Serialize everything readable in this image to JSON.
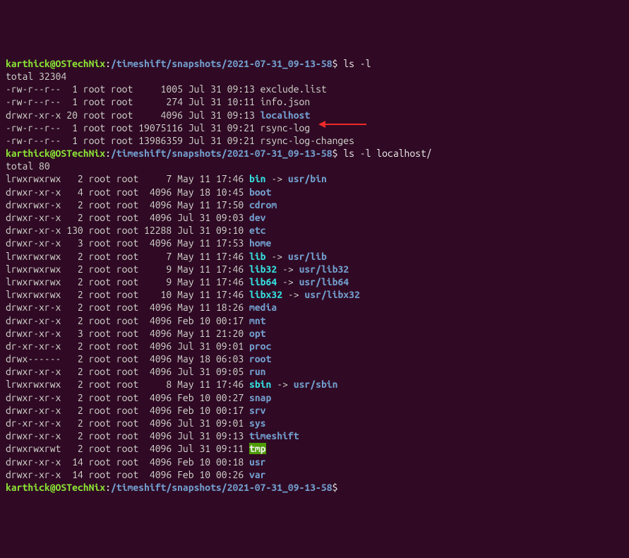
{
  "prompt1": {
    "user": "karthick@OSTechNix",
    "colon": ":",
    "path": "/timeshift/snapshots/2021-07-31_09-13-58",
    "dollar": "$",
    "cmd": " ls -l"
  },
  "total1": "total 32304",
  "listing1": [
    {
      "perm": "-rw-r--r--",
      "links": "  1",
      "owner": " root",
      "group": " root",
      "size": "     1005",
      "date": " Jul 31 09:13 ",
      "name": "exclude.list",
      "type": "file"
    },
    {
      "perm": "-rw-r--r--",
      "links": "  1",
      "owner": " root",
      "group": " root",
      "size": "      274",
      "date": " Jul 31 10:11 ",
      "name": "info.json",
      "type": "file"
    },
    {
      "perm": "drwxr-xr-x",
      "links": " 20",
      "owner": " root",
      "group": " root",
      "size": "     4096",
      "date": " Jul 31 09:13 ",
      "name": "localhost",
      "type": "dir",
      "arrow": true
    },
    {
      "perm": "-rw-r--r--",
      "links": "  1",
      "owner": " root",
      "group": " root",
      "size": " 19075116",
      "date": " Jul 31 09:21 ",
      "name": "rsync-log",
      "type": "file"
    },
    {
      "perm": "-rw-r--r--",
      "links": "  1",
      "owner": " root",
      "group": " root",
      "size": " 13986359",
      "date": " Jul 31 09:21 ",
      "name": "rsync-log-changes",
      "type": "file"
    }
  ],
  "prompt2": {
    "user": "karthick@OSTechNix",
    "colon": ":",
    "path": "/timeshift/snapshots/2021-07-31_09-13-58",
    "dollar": "$",
    "cmd": " ls -l localhost/"
  },
  "total2": "total 80",
  "listing2": [
    {
      "perm": "lrwxrwxrwx",
      "links": "   2",
      "owner": " root",
      "group": " root",
      "size": "     7",
      "date": " May 11 17:46 ",
      "name": "bin",
      "type": "link",
      "target": "usr/bin"
    },
    {
      "perm": "drwxr-xr-x",
      "links": "   4",
      "owner": " root",
      "group": " root",
      "size": "  4096",
      "date": " May 18 10:45 ",
      "name": "boot",
      "type": "dir"
    },
    {
      "perm": "drwxrwxr-x",
      "links": "   2",
      "owner": " root",
      "group": " root",
      "size": "  4096",
      "date": " May 11 17:50 ",
      "name": "cdrom",
      "type": "dir"
    },
    {
      "perm": "drwxr-xr-x",
      "links": "   2",
      "owner": " root",
      "group": " root",
      "size": "  4096",
      "date": " Jul 31 09:03 ",
      "name": "dev",
      "type": "dir"
    },
    {
      "perm": "drwxr-xr-x",
      "links": " 130",
      "owner": " root",
      "group": " root",
      "size": " 12288",
      "date": " Jul 31 09:10 ",
      "name": "etc",
      "type": "dir"
    },
    {
      "perm": "drwxr-xr-x",
      "links": "   3",
      "owner": " root",
      "group": " root",
      "size": "  4096",
      "date": " May 11 17:53 ",
      "name": "home",
      "type": "dir"
    },
    {
      "perm": "lrwxrwxrwx",
      "links": "   2",
      "owner": " root",
      "group": " root",
      "size": "     7",
      "date": " May 11 17:46 ",
      "name": "lib",
      "type": "link",
      "target": "usr/lib"
    },
    {
      "perm": "lrwxrwxrwx",
      "links": "   2",
      "owner": " root",
      "group": " root",
      "size": "     9",
      "date": " May 11 17:46 ",
      "name": "lib32",
      "type": "link",
      "target": "usr/lib32"
    },
    {
      "perm": "lrwxrwxrwx",
      "links": "   2",
      "owner": " root",
      "group": " root",
      "size": "     9",
      "date": " May 11 17:46 ",
      "name": "lib64",
      "type": "link",
      "target": "usr/lib64"
    },
    {
      "perm": "lrwxrwxrwx",
      "links": "   2",
      "owner": " root",
      "group": " root",
      "size": "    10",
      "date": " May 11 17:46 ",
      "name": "libx32",
      "type": "link",
      "target": "usr/libx32"
    },
    {
      "perm": "drwxr-xr-x",
      "links": "   2",
      "owner": " root",
      "group": " root",
      "size": "  4096",
      "date": " May 11 18:26 ",
      "name": "media",
      "type": "dir"
    },
    {
      "perm": "drwxr-xr-x",
      "links": "   2",
      "owner": " root",
      "group": " root",
      "size": "  4096",
      "date": " Feb 10 00:17 ",
      "name": "mnt",
      "type": "dir"
    },
    {
      "perm": "drwxr-xr-x",
      "links": "   3",
      "owner": " root",
      "group": " root",
      "size": "  4096",
      "date": " May 11 21:20 ",
      "name": "opt",
      "type": "dir"
    },
    {
      "perm": "dr-xr-xr-x",
      "links": "   2",
      "owner": " root",
      "group": " root",
      "size": "  4096",
      "date": " Jul 31 09:01 ",
      "name": "proc",
      "type": "dir"
    },
    {
      "perm": "drwx------",
      "links": "   2",
      "owner": " root",
      "group": " root",
      "size": "  4096",
      "date": " May 18 06:03 ",
      "name": "root",
      "type": "dir"
    },
    {
      "perm": "drwxr-xr-x",
      "links": "   2",
      "owner": " root",
      "group": " root",
      "size": "  4096",
      "date": " Jul 31 09:05 ",
      "name": "run",
      "type": "dir"
    },
    {
      "perm": "lrwxrwxrwx",
      "links": "   2",
      "owner": " root",
      "group": " root",
      "size": "     8",
      "date": " May 11 17:46 ",
      "name": "sbin",
      "type": "link",
      "target": "usr/sbin"
    },
    {
      "perm": "drwxr-xr-x",
      "links": "   2",
      "owner": " root",
      "group": " root",
      "size": "  4096",
      "date": " Feb 10 00:27 ",
      "name": "snap",
      "type": "dir"
    },
    {
      "perm": "drwxr-xr-x",
      "links": "   2",
      "owner": " root",
      "group": " root",
      "size": "  4096",
      "date": " Feb 10 00:17 ",
      "name": "srv",
      "type": "dir"
    },
    {
      "perm": "dr-xr-xr-x",
      "links": "   2",
      "owner": " root",
      "group": " root",
      "size": "  4096",
      "date": " Jul 31 09:01 ",
      "name": "sys",
      "type": "dir"
    },
    {
      "perm": "drwxr-xr-x",
      "links": "   2",
      "owner": " root",
      "group": " root",
      "size": "  4096",
      "date": " Jul 31 09:13 ",
      "name": "timeshift",
      "type": "dir"
    },
    {
      "perm": "drwxrwxrwt",
      "links": "   2",
      "owner": " root",
      "group": " root",
      "size": "  4096",
      "date": " Jul 31 09:11 ",
      "name": "tmp",
      "type": "sticky"
    },
    {
      "perm": "drwxr-xr-x",
      "links": "  14",
      "owner": " root",
      "group": " root",
      "size": "  4096",
      "date": " Feb 10 00:18 ",
      "name": "usr",
      "type": "dir"
    },
    {
      "perm": "drwxr-xr-x",
      "links": "  14",
      "owner": " root",
      "group": " root",
      "size": "  4096",
      "date": " Feb 10 00:26 ",
      "name": "var",
      "type": "dir"
    }
  ],
  "prompt3": {
    "user": "karthick@OSTechNix",
    "colon": ":",
    "path": "/timeshift/snapshots/2021-07-31_09-13-58",
    "dollar": "$",
    "cmd": " "
  },
  "link_sep": " -> "
}
